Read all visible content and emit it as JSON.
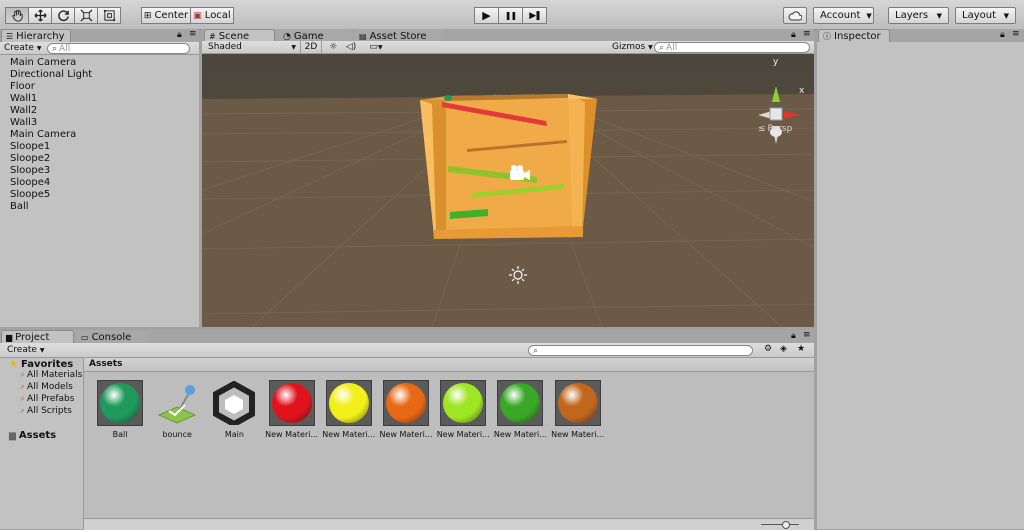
{
  "toolbar": {
    "tools": [
      {
        "name": "hand-tool-button",
        "icon": "hand-icon",
        "active": true
      },
      {
        "name": "move-tool-button",
        "icon": "move-icon",
        "active": false
      },
      {
        "name": "rotate-tool-button",
        "icon": "rotate-icon",
        "active": false
      },
      {
        "name": "scale-tool-button",
        "icon": "scale-icon",
        "active": false
      },
      {
        "name": "rect-tool-button",
        "icon": "rect-icon",
        "active": false
      }
    ],
    "pivot_label": "Center",
    "space_label": "Local",
    "play_icon": "▶",
    "pause_icon": "❚❚",
    "step_icon": "▶❚",
    "cloud_icon": "cloud-icon",
    "account_label": "Account",
    "layers_label": "Layers",
    "layout_label": "Layout"
  },
  "hierarchy": {
    "tab_label": "Hierarchy",
    "create_label": "Create",
    "search_placeholder": "All",
    "items": [
      "Main Camera",
      "Directional Light",
      "Floor",
      "Wall1",
      "Wall2",
      "Wall3",
      "Main Camera",
      "Sloope1",
      "Sloope2",
      "Sloope3",
      "Sloope4",
      "Sloope5",
      "Ball"
    ]
  },
  "scene": {
    "tabs": [
      "Scene",
      "Game",
      "Asset Store"
    ],
    "shading": "Shaded",
    "mode_2d": "2D",
    "gizmos_label": "Gizmos",
    "search_placeholder": "All",
    "persp_label": "Persp",
    "axis_y": "y",
    "axis_x": "x",
    "colors": {
      "sky": "#4f4a3f",
      "ground": "#6b5b45",
      "box": "#f4b04a"
    }
  },
  "inspector": {
    "tab_label": "Inspector"
  },
  "project": {
    "tabs": [
      "Project",
      "Console"
    ],
    "create_label": "Create",
    "favorites_label": "Favorites",
    "favorites": [
      "All Materials",
      "All Models",
      "All Prefabs",
      "All Scripts"
    ],
    "assets_folder": "Assets",
    "assets_header": "Assets",
    "assets": [
      {
        "label": "Ball",
        "kind": "sphere",
        "color": "#1f9a5a"
      },
      {
        "label": "bounce",
        "kind": "physics",
        "color": "#8dc34a"
      },
      {
        "label": "Main",
        "kind": "unity",
        "color": "#222222"
      },
      {
        "label": "New Materi...",
        "kind": "sphere",
        "color": "#e0131c"
      },
      {
        "label": "New Materi...",
        "kind": "sphere",
        "color": "#f1f01b"
      },
      {
        "label": "New Materi...",
        "kind": "sphere",
        "color": "#e86915"
      },
      {
        "label": "New Materi...",
        "kind": "sphere",
        "color": "#9ee623"
      },
      {
        "label": "New Materi...",
        "kind": "sphere",
        "color": "#3aa826"
      },
      {
        "label": "New Materi...",
        "kind": "sphere",
        "color": "#c0661d"
      }
    ]
  }
}
